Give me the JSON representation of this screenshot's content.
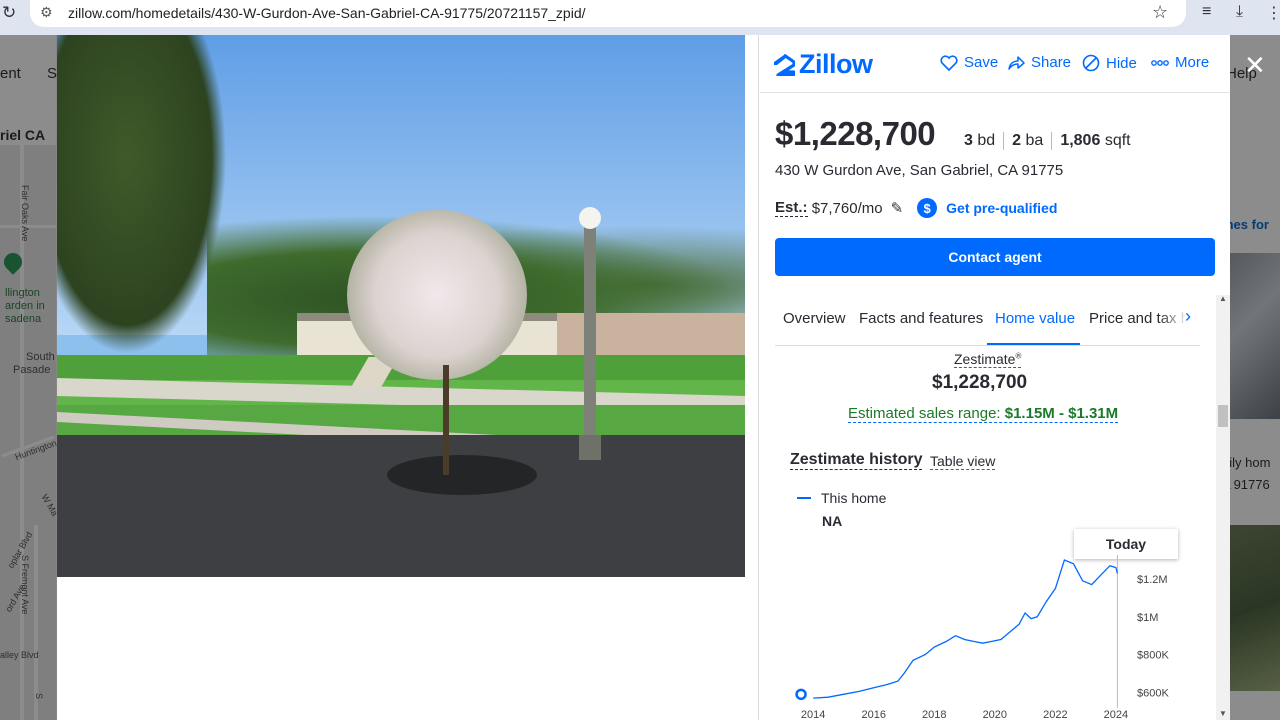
{
  "browser": {
    "url": "zillow.com/homedetails/430-W-Gurdon-Ave-San-Gabriel-CA-91775/20721157_zpid/"
  },
  "background": {
    "nav_fragment_1": "ent",
    "nav_fragment_2": "S",
    "location_fragment": "riel CA",
    "help_fragment": "Help",
    "map_labels": [
      "Fair Oaks Ave",
      "llington",
      "arden in",
      "sadena",
      "South",
      "Pasade",
      "Huntington",
      "W Ma",
      "oplar Blvd",
      "S Fremont Ave",
      "ord Ave",
      "alley Blvd",
      "S"
    ],
    "right_link": "mes for",
    "right_text_1": "nily hom",
    "right_text_2": "A 91776"
  },
  "header": {
    "logo_text": "Zillow",
    "save_label": "Save",
    "share_label": "Share",
    "hide_label": "Hide",
    "more_label": "More"
  },
  "listing": {
    "price": "$1,228,700",
    "beds_value": "3",
    "beds_unit": "bd",
    "baths_value": "2",
    "baths_unit": "ba",
    "sqft_value": "1,806",
    "sqft_unit": "sqft",
    "address": "430 W Gurdon Ave, San Gabriel, CA 91775",
    "est_label": "Est.:",
    "est_value": "$7,760/mo",
    "prequal_label": "Get pre-qualified",
    "contact_label": "Contact agent"
  },
  "tabs": {
    "items": [
      "Overview",
      "Facts and features",
      "Home value",
      "Price and tax h"
    ],
    "active": "Home value"
  },
  "zestimate": {
    "label": "Zestimate",
    "reg": "®",
    "value": "$1,228,700",
    "range_label": "Estimated sales range:",
    "range_value": "$1.15M - $1.31M"
  },
  "history": {
    "title": "Zestimate history",
    "table_view_label": "Table view",
    "legend_label": "This home",
    "legend_value": "NA",
    "tooltip_label": "Today"
  },
  "colors": {
    "brand": "#006aff",
    "range_green": "#1a7a2a",
    "text": "#2a2a33"
  },
  "chart_data": {
    "type": "line",
    "x_ticks": [
      "2014",
      "2016",
      "2018",
      "2020",
      "2022",
      "2024"
    ],
    "y_ticks": [
      "$1.2M",
      "$1M",
      "$800K",
      "$600K"
    ],
    "ylim": [
      560000,
      1300000
    ],
    "xlim": [
      2013.4,
      2024.3
    ],
    "series": [
      {
        "name": "This home",
        "points": [
          [
            2014.0,
            570000
          ],
          [
            2014.5,
            575000
          ],
          [
            2015.0,
            590000
          ],
          [
            2015.5,
            605000
          ],
          [
            2016.0,
            625000
          ],
          [
            2016.4,
            640000
          ],
          [
            2016.8,
            660000
          ],
          [
            2017.0,
            700000
          ],
          [
            2017.3,
            770000
          ],
          [
            2017.7,
            800000
          ],
          [
            2018.0,
            840000
          ],
          [
            2018.4,
            870000
          ],
          [
            2018.7,
            900000
          ],
          [
            2019.0,
            880000
          ],
          [
            2019.3,
            870000
          ],
          [
            2019.6,
            860000
          ],
          [
            2019.9,
            870000
          ],
          [
            2020.2,
            880000
          ],
          [
            2020.5,
            920000
          ],
          [
            2020.8,
            960000
          ],
          [
            2021.0,
            1020000
          ],
          [
            2021.2,
            990000
          ],
          [
            2021.4,
            1000000
          ],
          [
            2021.7,
            1080000
          ],
          [
            2022.0,
            1150000
          ],
          [
            2022.3,
            1300000
          ],
          [
            2022.6,
            1280000
          ],
          [
            2022.9,
            1190000
          ],
          [
            2023.2,
            1170000
          ],
          [
            2023.5,
            1220000
          ],
          [
            2023.8,
            1270000
          ],
          [
            2024.0,
            1260000
          ],
          [
            2024.05,
            1228700
          ]
        ]
      }
    ],
    "marker_start_year": 2013.6,
    "marker_start_value": 590000
  }
}
